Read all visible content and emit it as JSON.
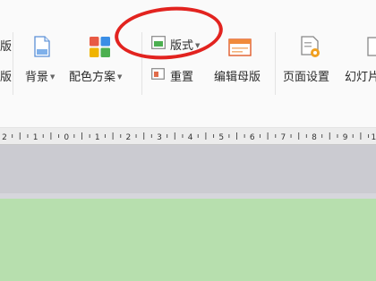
{
  "toolbar": {
    "partial_left_top": "版",
    "partial_left_bottom": "版",
    "background": "背景",
    "color_scheme": "配色方案",
    "layout": "版式",
    "reset": "重置",
    "edit_master": "编辑母版",
    "page_setup": "页面设置",
    "slideshow_partial": "幻灯片"
  },
  "ruler": {
    "labels": [
      "2",
      "1",
      "0",
      "1",
      "2",
      "3",
      "4",
      "5",
      "6",
      "7",
      "8",
      "9",
      "10"
    ]
  },
  "colors": {
    "annotation_circle": "#e2231f",
    "slide_background": "#b7dfae",
    "workspace": "#cbcbd1"
  },
  "icons": [
    "background-icon",
    "color-scheme-icon",
    "layout-icon",
    "reset-icon",
    "edit-master-icon",
    "page-setup-icon",
    "slideshow-icon"
  ]
}
